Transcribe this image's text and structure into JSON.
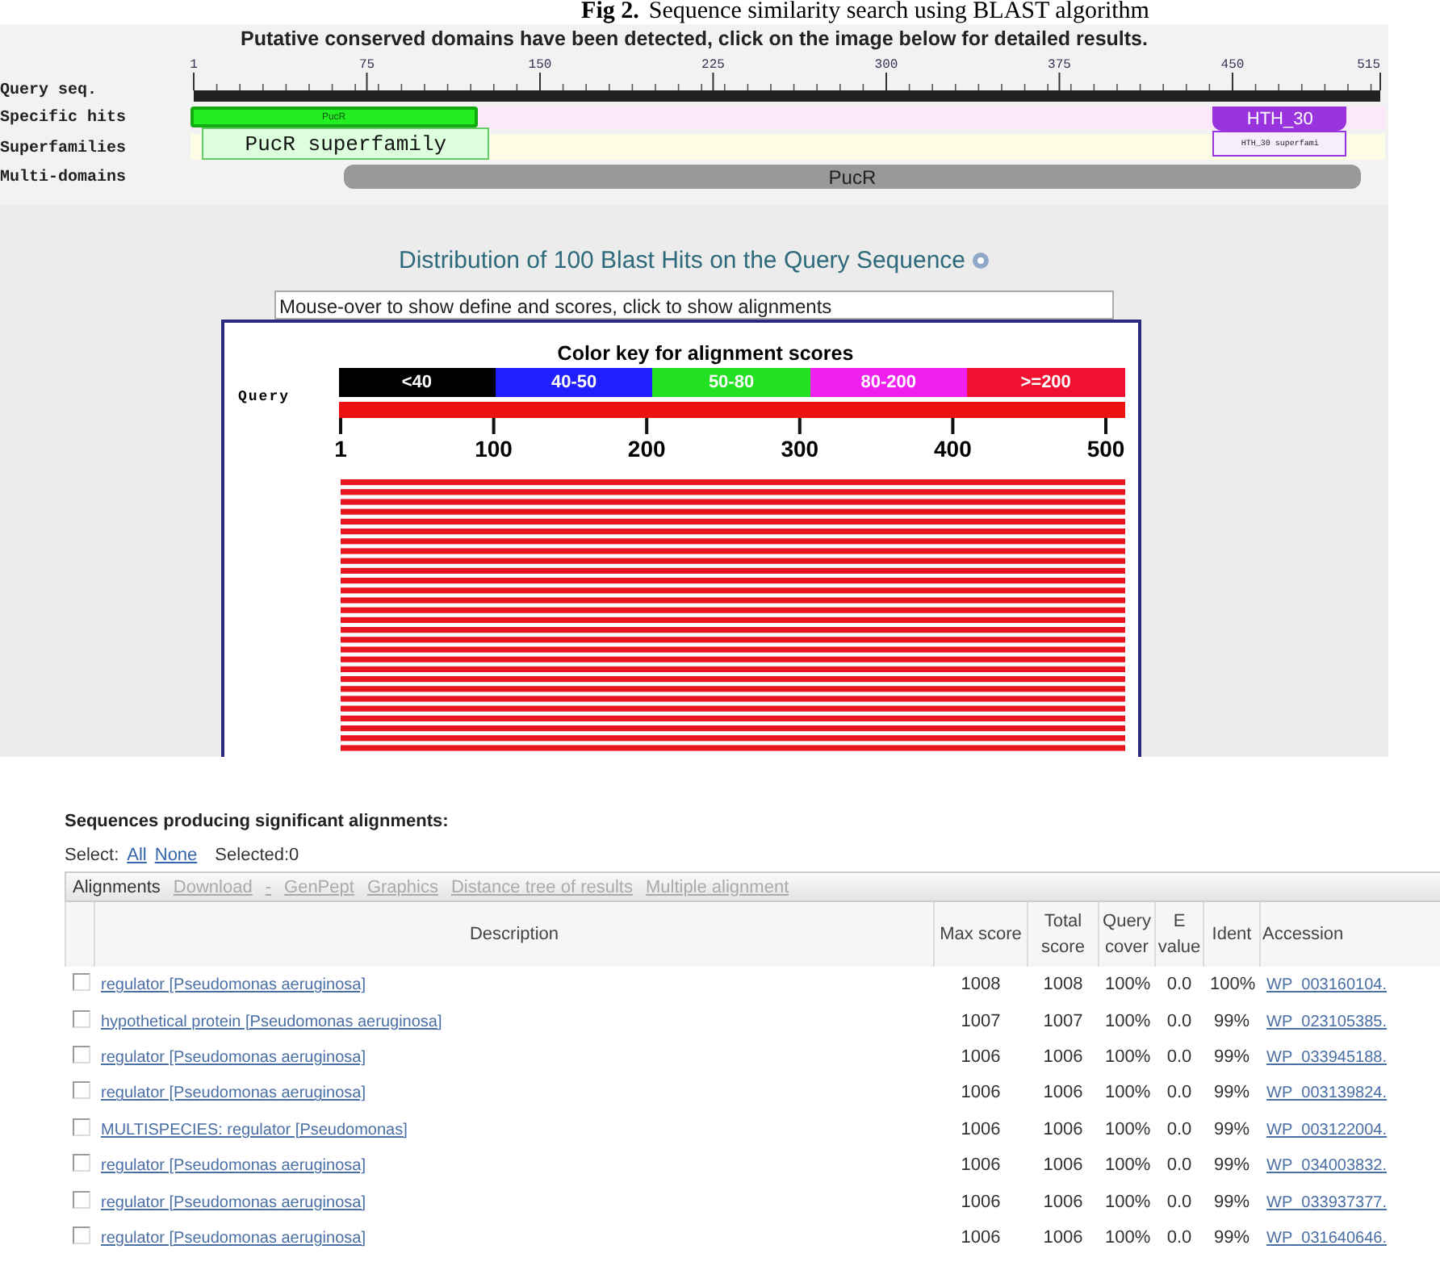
{
  "caption": {
    "label": "Fig 2.",
    "text": "Sequence similarity search using BLAST algorithm"
  },
  "domains": {
    "title": "Putative conserved domains have been detected, click on the image below for detailed results.",
    "ruler_labels": [
      "1",
      "75",
      "150",
      "225",
      "300",
      "375",
      "450",
      "515"
    ],
    "rows": [
      {
        "label": "Query seq.",
        "kind": "ruler",
        "bars": []
      },
      {
        "label": "Specific hits",
        "kind": "specific",
        "bars": [
          {
            "text": "PucR",
            "kind": "specific"
          },
          {
            "text": "HTH_30",
            "kind": "specific-alt"
          }
        ]
      },
      {
        "label": "Superfamilies",
        "kind": "superfamily",
        "bars": [
          {
            "text": "PucR superfamily",
            "kind": "superfamily"
          },
          {
            "text": "HTH_30 superfami",
            "kind": "superfamily-alt"
          }
        ]
      },
      {
        "label": "Multi-domains",
        "kind": "multi",
        "bars": [
          {
            "text": "PucR",
            "kind": "multi"
          }
        ]
      }
    ]
  },
  "distribution": {
    "title": "Distribution of 100 Blast Hits on the Query Sequence",
    "hint": "Mouse-over to show define and scores, click to show alignments",
    "key_title": "Color key for alignment scores",
    "key": [
      {
        "label": "<40",
        "color": "#000000"
      },
      {
        "label": "40-50",
        "color": "#1f1fff"
      },
      {
        "label": "50-80",
        "color": "#22e022"
      },
      {
        "label": "80-200",
        "color": "#f020f0"
      },
      {
        "label": ">=200",
        "color": "#f01030"
      }
    ],
    "query_label": "Query",
    "ticks": [
      "1",
      "100",
      "200",
      "300",
      "400",
      "500"
    ]
  },
  "results": {
    "title": "Sequences producing significant alignments:",
    "select_label": "Select:",
    "select_links": [
      "All",
      "None"
    ],
    "selected": "Selected:0",
    "toolbar": [
      {
        "label": "Alignments",
        "disabled": false
      },
      {
        "label": "Download",
        "disabled": true
      },
      {
        "label": "-",
        "disabled": true
      },
      {
        "label": "GenPept",
        "disabled": true
      },
      {
        "label": "Graphics",
        "disabled": true
      },
      {
        "label": "Distance tree of results",
        "disabled": true
      },
      {
        "label": "Multiple alignment",
        "disabled": true
      }
    ],
    "columns": [
      "Description",
      "Max score",
      "Total score",
      "Query cover",
      "E value",
      "Ident",
      "Accession"
    ],
    "rows": [
      {
        "checked": false,
        "cells": [
          "regulator [Pseudomonas aeruginosa]",
          "1008",
          "1008",
          "100%",
          "0.0",
          "100%",
          "WP_003160104."
        ]
      },
      {
        "checked": false,
        "cells": [
          "hypothetical protein [Pseudomonas aeruginosa]",
          "1007",
          "1007",
          "100%",
          "0.0",
          "99%",
          "WP_023105385."
        ]
      },
      {
        "checked": false,
        "cells": [
          "regulator [Pseudomonas aeruginosa]",
          "1006",
          "1006",
          "100%",
          "0.0",
          "99%",
          "WP_033945188."
        ]
      },
      {
        "checked": false,
        "cells": [
          "regulator [Pseudomonas aeruginosa]",
          "1006",
          "1006",
          "100%",
          "0.0",
          "99%",
          "WP_003139824."
        ]
      },
      {
        "checked": false,
        "cells": [
          "MULTISPECIES: regulator [Pseudomonas]",
          "1006",
          "1006",
          "100%",
          "0.0",
          "99%",
          "WP_003122004."
        ]
      },
      {
        "checked": false,
        "cells": [
          "regulator [Pseudomonas aeruginosa]",
          "1006",
          "1006",
          "100%",
          "0.0",
          "99%",
          "WP_034003832."
        ]
      },
      {
        "checked": false,
        "cells": [
          "regulator [Pseudomonas aeruginosa]",
          "1006",
          "1006",
          "100%",
          "0.0",
          "99%",
          "WP_033937377."
        ]
      },
      {
        "checked": false,
        "cells": [
          "regulator [Pseudomonas aeruginosa]",
          "1006",
          "1006",
          "100%",
          "0.0",
          "99%",
          "WP_031640646."
        ]
      }
    ]
  }
}
